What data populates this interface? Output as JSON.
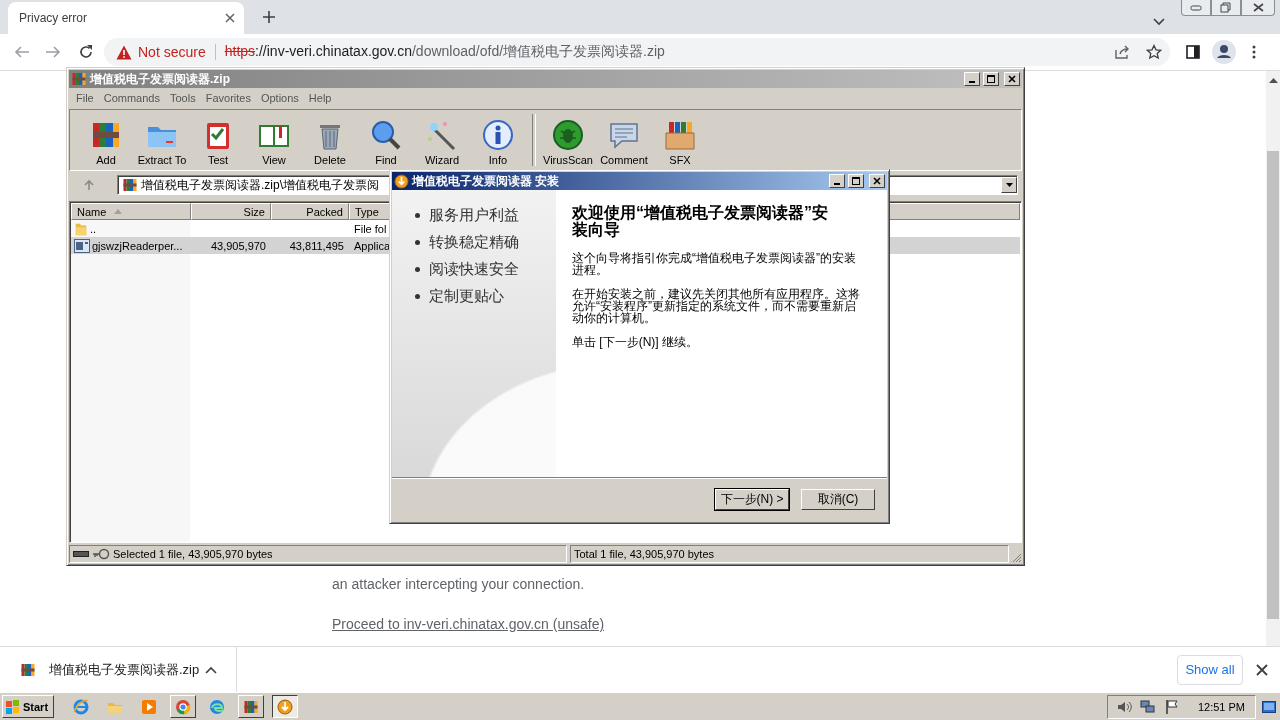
{
  "browser": {
    "tab": {
      "title": "Privacy error",
      "selected": true
    },
    "address": {
      "security": "Not secure",
      "url": [
        {
          "kind": "scheme",
          "text": "https"
        },
        {
          "kind": "host",
          "text": "://inv-veri.chinatax.gov.cn"
        },
        {
          "kind": "path",
          "text": "/download/ofd/增值税电子发票阅读器.zip"
        }
      ]
    }
  },
  "page": {
    "text": "an attacker intercepting your connection.",
    "link": "Proceed to inv-veri.chinatax.gov.cn (unsafe)"
  },
  "download_bar": {
    "file": "增值税电子发票阅读器.zip",
    "show_all": "Show all"
  },
  "taskbar": {
    "start": "Start",
    "time": "12:51 PM",
    "items": [
      {
        "kind": "launcher"
      },
      {
        "kind": "launcher"
      },
      {
        "kind": "launcher"
      },
      {
        "kind": "task",
        "selected": false
      },
      {
        "kind": "launcher"
      },
      {
        "kind": "task",
        "selected": false
      },
      {
        "kind": "task",
        "selected": true
      }
    ]
  },
  "archiver": {
    "title": "增值税电子发票阅读器.zip",
    "menu": [
      "File",
      "Commands",
      "Tools",
      "Favorites",
      "Options",
      "Help"
    ],
    "toolbar": [
      "Add",
      "Extract To",
      "Test",
      "View",
      "Delete",
      "Find",
      "Wizard",
      "Info",
      "VirusScan",
      "Comment",
      "SFX"
    ],
    "path": "增值税电子发票阅读器.zip\\增值税电子发票阅",
    "columns": [
      "Name",
      "Size",
      "Packed",
      "Type"
    ],
    "rows": [
      {
        "kind": "folder",
        "name": "..",
        "type": "File fol",
        "selected": false
      },
      {
        "kind": "file",
        "name": "gjswzjReaderper...",
        "size": "43,905,970",
        "packed": "43,811,495",
        "type": "Applica",
        "selected": true
      }
    ],
    "status": [
      "Selected 1 file, 43,905,970 bytes",
      "Total 1 file, 43,905,970 bytes"
    ]
  },
  "installer": {
    "title": "增值税电子发票阅读器 安装",
    "features": [
      "服务用户利益",
      "转换稳定精确",
      "阅读快速安全",
      "定制更贴心"
    ],
    "heading": "欢迎使用“增值税电子发票阅读器”安装向导",
    "paragraphs": [
      "这个向导将指引你完成“增值税电子发票阅读器”的安装进程。",
      "在开始安装之前，建议先关闭其他所有应用程序。这将允许“安装程序”更新指定的系统文件，而不需要重新启动你的计算机。",
      "单击 [下一步(N)] 继续。"
    ],
    "buttons": [
      {
        "label": "下一步(N) >",
        "default": true
      },
      {
        "label": "取消(C)",
        "default": false
      }
    ]
  }
}
